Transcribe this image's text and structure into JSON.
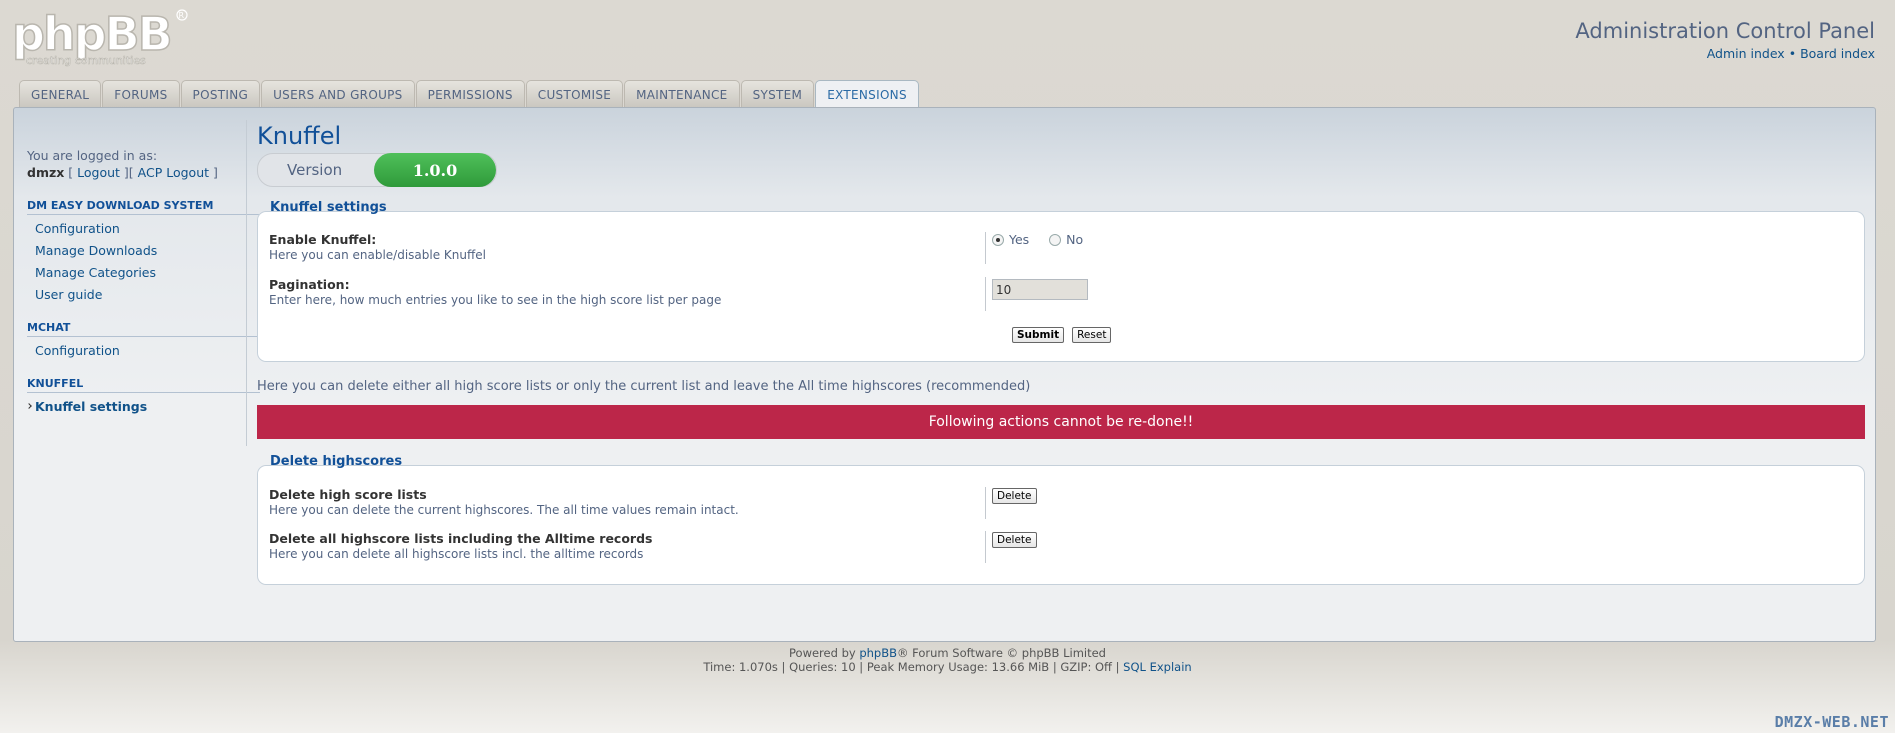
{
  "header": {
    "logo_text": "phpBB",
    "logo_tagline": "creating communities",
    "title": "Administration Control Panel",
    "links": [
      "Admin index",
      "Board index"
    ],
    "link_separator": "•"
  },
  "tabs": [
    {
      "label": "General",
      "active": false
    },
    {
      "label": "Forums",
      "active": false
    },
    {
      "label": "Posting",
      "active": false
    },
    {
      "label": "Users and Groups",
      "active": false
    },
    {
      "label": "Permissions",
      "active": false
    },
    {
      "label": "Customise",
      "active": false
    },
    {
      "label": "Maintenance",
      "active": false
    },
    {
      "label": "System",
      "active": false
    },
    {
      "label": "Extensions",
      "active": true
    }
  ],
  "sidebar": {
    "logged_in_as": "You are logged in as:",
    "username": "dmzx",
    "logout": "Logout",
    "acp_logout": "ACP Logout",
    "sections": [
      {
        "title": "DM Easy Download System",
        "items": [
          "Configuration",
          "Manage Downloads",
          "Manage Categories",
          "User guide"
        ]
      },
      {
        "title": "mChat",
        "items": [
          "Configuration"
        ]
      },
      {
        "title": "Knuffel",
        "items": [
          "Knuffel settings"
        ],
        "active_item": "Knuffel settings"
      }
    ]
  },
  "main": {
    "title": "Knuffel",
    "version_label": "Version",
    "version_value": "1.0.0",
    "settings": {
      "legend": "Knuffel settings",
      "enable_label": "Enable Knuffel:",
      "enable_explain": "Here you can enable/disable Knuffel",
      "yes": "Yes",
      "no": "No",
      "enabled": true,
      "pagination_label": "Pagination:",
      "pagination_explain": "Enter here, how much entries you like to see in the high score list per page",
      "pagination_value": "10",
      "submit": "Submit",
      "reset": "Reset"
    },
    "info": "Here you can delete either all high score lists or only the current list and leave the All time highscores (recommended)",
    "warning": "Following actions cannot be re-done!!",
    "delete": {
      "legend": "Delete highscores",
      "row1_label": "Delete high score lists",
      "row1_explain": "Here you can delete the current highscores. The all time values remain intact.",
      "row2_label": "Delete all highscore lists including the Alltime records",
      "row2_explain": "Here you can delete all highscore lists incl. the alltime records",
      "button": "Delete"
    }
  },
  "footer": {
    "powered_prefix": "Powered by ",
    "powered_link": "phpBB",
    "powered_suffix": "® Forum Software © phpBB Limited",
    "stats": "Time: 1.070s | Queries: 10 | Peak Memory Usage: 13.66 MiB | GZIP: Off | ",
    "sql_explain": "SQL Explain"
  },
  "watermark": "DMZX-WEB.NET",
  "colors": {
    "accent": "#115098",
    "warning": "#bc2649",
    "version_green": "#3aa845"
  }
}
